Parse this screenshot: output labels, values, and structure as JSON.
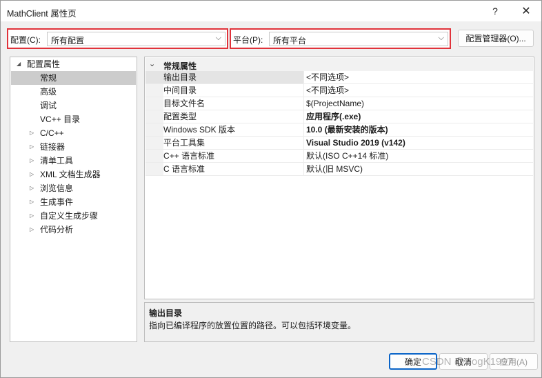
{
  "window": {
    "title": "MathClient 属性页",
    "help_label": "?",
    "close_label": "✕"
  },
  "config": {
    "label": "配置(C):",
    "value": "所有配置",
    "arrow": "⌵"
  },
  "platform": {
    "label": "平台(P):",
    "value": "所有平台",
    "arrow": "⌵"
  },
  "config_manager_label": "配置管理器(O)...",
  "tree": {
    "items": [
      {
        "label": "配置属性",
        "caret": "◢",
        "level": 0
      },
      {
        "label": "常规",
        "caret": "",
        "level": 1,
        "selected": true
      },
      {
        "label": "高级",
        "caret": "",
        "level": 1
      },
      {
        "label": "调试",
        "caret": "",
        "level": 1
      },
      {
        "label": "VC++ 目录",
        "caret": "",
        "level": 1
      },
      {
        "label": "C/C++",
        "caret": "▷",
        "level": 1
      },
      {
        "label": "链接器",
        "caret": "▷",
        "level": 1
      },
      {
        "label": "清单工具",
        "caret": "▷",
        "level": 1
      },
      {
        "label": "XML 文档生成器",
        "caret": "▷",
        "level": 1
      },
      {
        "label": "浏览信息",
        "caret": "▷",
        "level": 1
      },
      {
        "label": "生成事件",
        "caret": "▷",
        "level": 1
      },
      {
        "label": "自定义生成步骤",
        "caret": "▷",
        "level": 1
      },
      {
        "label": "代码分析",
        "caret": "▷",
        "level": 1
      }
    ]
  },
  "grid": {
    "section_caret": "⌄",
    "section_title": "常规属性",
    "rows": [
      {
        "name": "输出目录",
        "value": "<不同选项>",
        "bold": false,
        "selected": true
      },
      {
        "name": "中间目录",
        "value": "<不同选项>",
        "bold": false
      },
      {
        "name": "目标文件名",
        "value": "$(ProjectName)",
        "bold": false
      },
      {
        "name": "配置类型",
        "value": "应用程序(.exe)",
        "bold": true
      },
      {
        "name": "Windows SDK 版本",
        "value": "10.0 (最新安装的版本)",
        "bold": true
      },
      {
        "name": "平台工具集",
        "value": "Visual Studio 2019 (v142)",
        "bold": true
      },
      {
        "name": "C++ 语言标准",
        "value": "默认(ISO C++14 标准)",
        "bold": false
      },
      {
        "name": "C 语言标准",
        "value": "默认(旧 MSVC)",
        "bold": false
      }
    ]
  },
  "description": {
    "title": "输出目录",
    "text": "指向已编译程序的放置位置的路径。可以包括环境变量。"
  },
  "buttons": {
    "ok": "确定",
    "cancel": "取消",
    "apply": "应用(A)"
  },
  "watermark": "CSDN @SogK1997"
}
